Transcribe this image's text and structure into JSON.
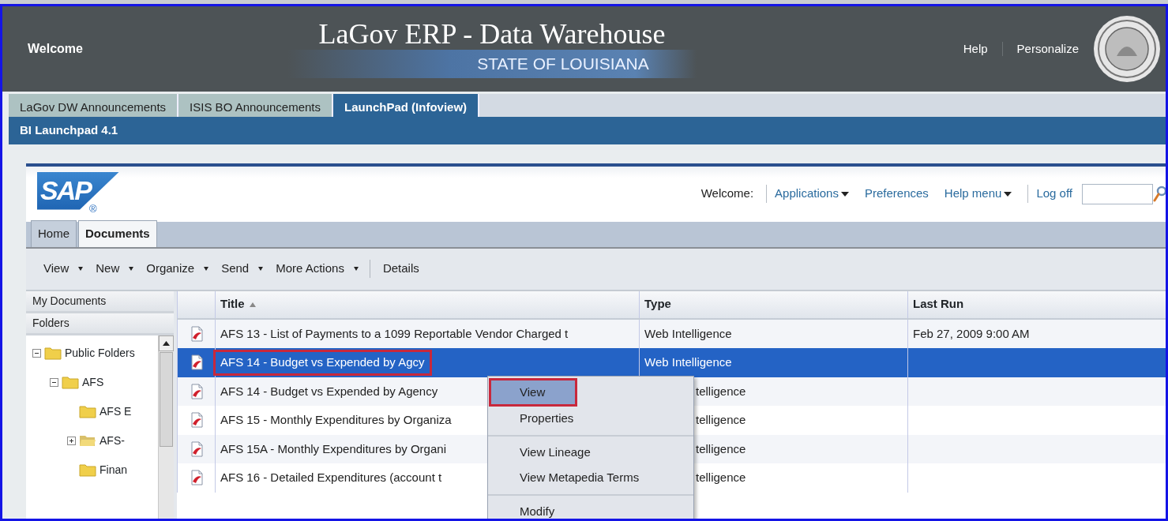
{
  "header": {
    "welcome": "Welcome",
    "title": "LaGov ERP - Data Warehouse",
    "subtitle": "STATE OF LOUISIANA",
    "links": [
      "Help",
      "Personalize"
    ]
  },
  "portal_tabs": [
    {
      "label": "LaGov DW Announcements",
      "selected": false
    },
    {
      "label": "ISIS BO Announcements",
      "selected": false
    },
    {
      "label": "LaunchPad (Infoview)",
      "selected": true
    }
  ],
  "portal_bar": {
    "title": "BI Launchpad 4.1"
  },
  "launchpad": {
    "logo": {
      "text": "SAP",
      "mark": "®"
    },
    "welcome": "Welcome:",
    "links": [
      {
        "label": "Applications",
        "dropdown": true,
        "separated": true
      },
      {
        "label": "Preferences",
        "dropdown": false,
        "separated": false
      },
      {
        "label": "Help menu",
        "dropdown": true,
        "separated": false
      },
      {
        "label": "Log off",
        "dropdown": false,
        "separated": true
      }
    ]
  },
  "tabs": [
    {
      "label": "Home",
      "selected": false
    },
    {
      "label": "Documents",
      "selected": true
    }
  ],
  "toolbar": [
    {
      "label": "View",
      "dropdown": true,
      "separated": false
    },
    {
      "label": "New",
      "dropdown": true,
      "separated": false
    },
    {
      "label": "Organize",
      "dropdown": true,
      "separated": false
    },
    {
      "label": "Send",
      "dropdown": true,
      "separated": false
    },
    {
      "label": "More Actions",
      "dropdown": true,
      "separated": false
    },
    {
      "label": "Details",
      "dropdown": false,
      "separated": true
    }
  ],
  "sidebar": {
    "sections": [
      "My Documents",
      "Folders"
    ],
    "tree": [
      {
        "label": "Public Folders",
        "expanded": true,
        "children": [
          {
            "label": "AFS",
            "expanded": true,
            "children": [
              {
                "label": "AFS E"
              },
              {
                "label": "AFS-",
                "expanded": false
              },
              {
                "label": "Finan"
              }
            ]
          }
        ]
      }
    ]
  },
  "table": {
    "columns": [
      {
        "label": "Title",
        "sorted": true
      },
      {
        "label": "Type",
        "sorted": false
      },
      {
        "label": "Last Run",
        "sorted": false
      }
    ],
    "rows": [
      {
        "title": "AFS 13 - List of Payments to a 1099 Reportable Vendor Charged t",
        "type": "Web Intelligence",
        "last_run": "Feb 27, 2009 9:00 AM",
        "selected": false,
        "callout": false
      },
      {
        "title": "AFS 14 - Budget vs Expended by Agcy",
        "type": "Web Intelligence",
        "selected": true,
        "callout": true
      },
      {
        "title": "AFS 14 - Budget vs Expended by Agency",
        "type": "telligence",
        "selected": false,
        "callout": false
      },
      {
        "title": "AFS 15 - Monthly Expenditures by Organiza",
        "type": "telligence",
        "selected": false,
        "callout": false
      },
      {
        "title": "AFS 15A - Monthly Expenditures by Organi",
        "type": "telligence",
        "selected": false,
        "callout": false
      },
      {
        "title": "AFS 16 - Detailed Expenditures (account t",
        "type": "telligence",
        "selected": false,
        "callout": false
      }
    ]
  },
  "context_menu": {
    "groups": [
      {
        "items": [
          {
            "label": "View",
            "selected": true,
            "callout": true
          },
          {
            "label": "Properties",
            "selected": false,
            "callout": false
          }
        ]
      },
      {
        "items": [
          {
            "label": "View Lineage",
            "selected": false,
            "callout": false
          },
          {
            "label": "View Metapedia Terms",
            "selected": false,
            "callout": false
          }
        ]
      },
      {
        "items": [
          {
            "label": "Modify",
            "selected": false,
            "callout": false
          }
        ]
      }
    ]
  }
}
